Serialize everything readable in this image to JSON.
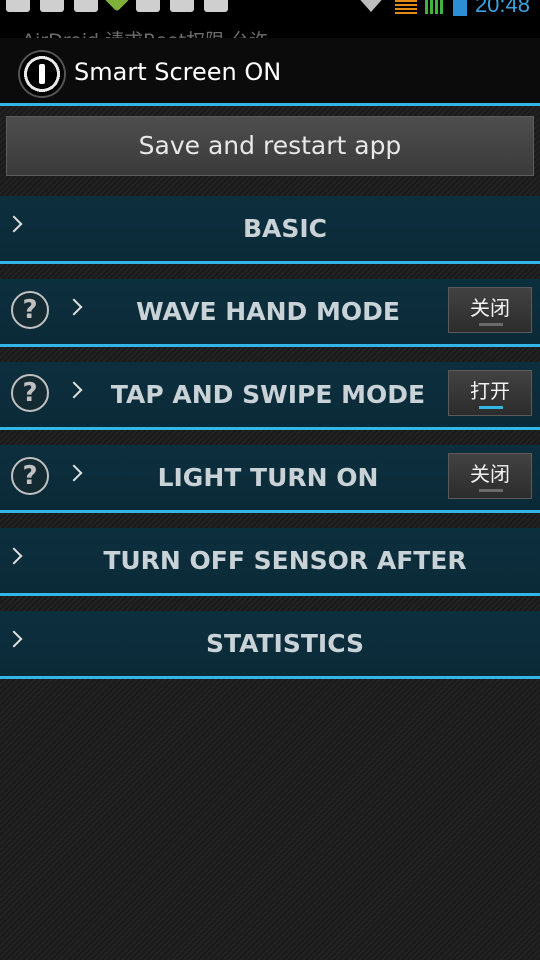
{
  "status_bar": {
    "ghost_text": "AirDroid 请求Root权限 允许",
    "time": "20:48"
  },
  "header": {
    "title": "Smart Screen ON",
    "icon": "power-icon"
  },
  "save_button": {
    "label": "Save and restart app"
  },
  "sections": [
    {
      "label": "BASIC",
      "has_help": false,
      "toggle": null
    },
    {
      "label": "WAVE HAND MODE",
      "has_help": true,
      "toggle": {
        "label": "关闭",
        "on": false
      }
    },
    {
      "label": "TAP AND SWIPE MODE",
      "has_help": true,
      "toggle": {
        "label": "打开",
        "on": true
      }
    },
    {
      "label": "LIGHT TURN ON",
      "has_help": true,
      "toggle": {
        "label": "关闭",
        "on": false
      }
    },
    {
      "label": "TURN OFF SENSOR AFTER",
      "has_help": false,
      "toggle": null
    },
    {
      "label": "STATISTICS",
      "has_help": false,
      "toggle": null
    }
  ],
  "help_glyph": "?",
  "colors": {
    "accent": "#33b5e5",
    "row_bg": "#0c2f3e"
  }
}
